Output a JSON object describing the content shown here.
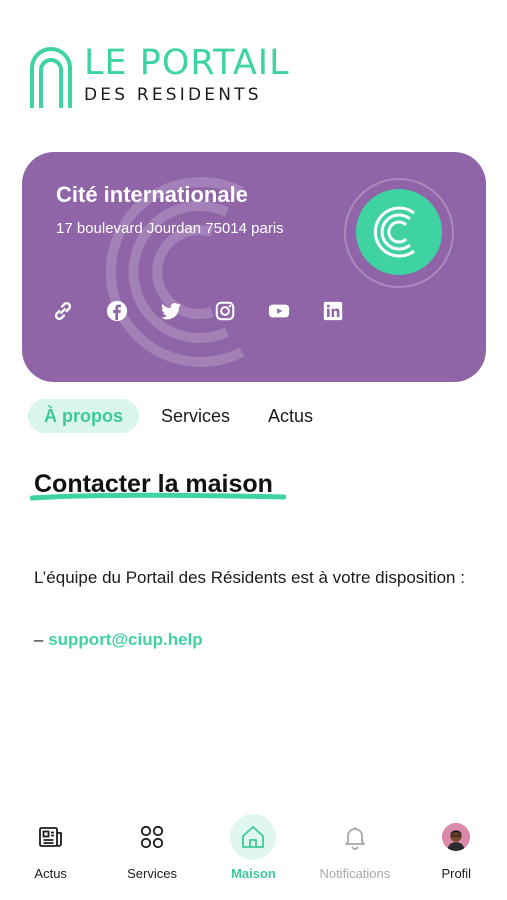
{
  "brand": {
    "line1": "LE PORTAIL",
    "line2": "DES RESIDENTS",
    "accent_color": "#3fd3a3",
    "icon": "arch-logo-icon"
  },
  "house_card": {
    "name": "Cité internationale",
    "address": "17 boulevard Jourdan 75014 paris",
    "background_color": "#8f65a8",
    "avatar_icon": "ciup-c-logo-icon",
    "socials": [
      {
        "icon": "link-icon"
      },
      {
        "icon": "facebook-icon"
      },
      {
        "icon": "twitter-icon"
      },
      {
        "icon": "instagram-icon"
      },
      {
        "icon": "youtube-icon"
      },
      {
        "icon": "linkedin-icon"
      }
    ]
  },
  "tabs": [
    {
      "label": "À propos",
      "active": true
    },
    {
      "label": "Services",
      "active": false
    },
    {
      "label": "Actus",
      "active": false
    }
  ],
  "content": {
    "title": "Contacter la maison",
    "intro": "L’équipe du Portail des Résidents est à votre disposition :",
    "dash": "–",
    "email": "support@ciup.help"
  },
  "bottom_nav": [
    {
      "label": "Actus",
      "icon": "newspaper-icon",
      "state": "normal"
    },
    {
      "label": "Services",
      "icon": "grid-circles-icon",
      "state": "normal"
    },
    {
      "label": "Maison",
      "icon": "house-icon",
      "state": "active"
    },
    {
      "label": "Notifications",
      "icon": "bell-icon",
      "state": "muted"
    },
    {
      "label": "Profil",
      "icon": "profile-avatar",
      "state": "normal"
    }
  ]
}
